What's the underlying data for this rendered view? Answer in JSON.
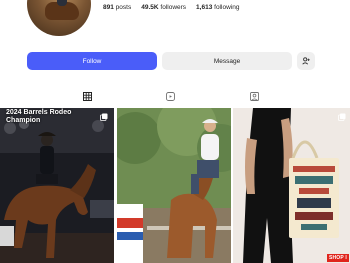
{
  "profile": {
    "stats": {
      "posts_count": "891",
      "posts_label": "posts",
      "followers_count": "49.5K",
      "followers_label": "followers",
      "following_count": "1,613",
      "following_label": "following"
    }
  },
  "actions": {
    "follow_label": "Follow",
    "message_label": "Message",
    "suggest_icon": "add-person-icon"
  },
  "tabs": [
    {
      "icon": "grid-icon"
    },
    {
      "icon": "reels-icon"
    },
    {
      "icon": "tagged-icon"
    }
  ],
  "posts": [
    {
      "caption": "2024 Barrels Rodeo Champion"
    },
    {
      "caption": ""
    },
    {
      "caption": "",
      "badge": "SHOP I"
    }
  ],
  "colors": {
    "accent": "#4a5df9",
    "button_gray": "#efefef",
    "shop_red": "#e0251c"
  }
}
